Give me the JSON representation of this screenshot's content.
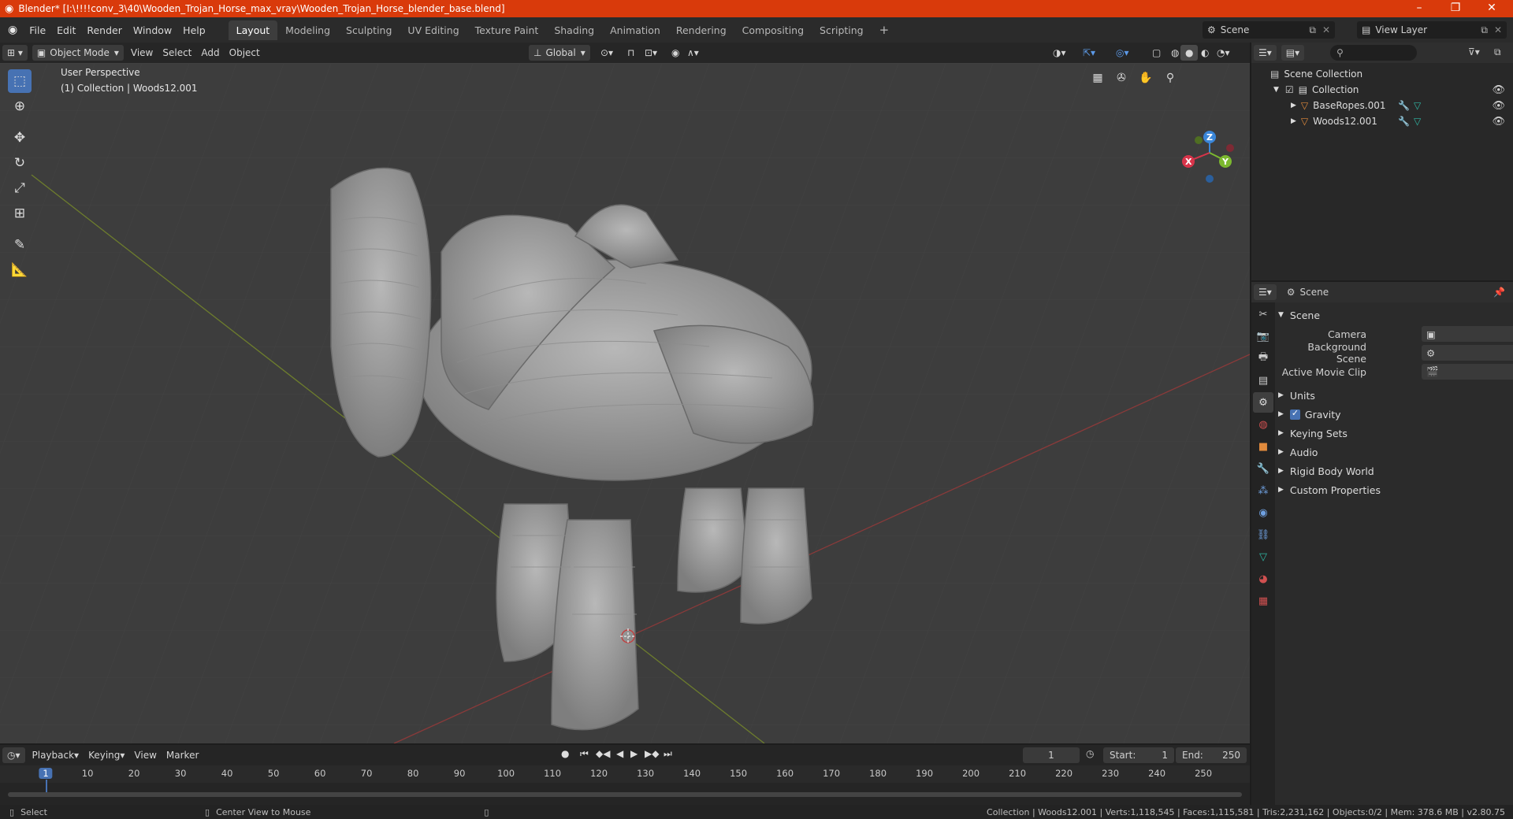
{
  "window": {
    "title": "Blender* [I:\\!!!!conv_3\\40\\Wooden_Trojan_Horse_max_vray\\Wooden_Trojan_Horse_blender_base.blend]"
  },
  "menus": [
    "File",
    "Edit",
    "Render",
    "Window",
    "Help"
  ],
  "workspaces": [
    "Layout",
    "Modeling",
    "Sculpting",
    "UV Editing",
    "Texture Paint",
    "Shading",
    "Animation",
    "Rendering",
    "Compositing",
    "Scripting"
  ],
  "active_workspace": "Layout",
  "scene_selector": "Scene",
  "view_layer_selector": "View Layer",
  "viewport_header": {
    "mode": "Object Mode",
    "menus": [
      "View",
      "Select",
      "Add",
      "Object"
    ],
    "orientation": "Global"
  },
  "viewport": {
    "perspective": "User Perspective",
    "collection_info": "(1) Collection | Woods12.001"
  },
  "gizmo_axes": {
    "x": "X",
    "y": "Y",
    "z": "Z"
  },
  "outliner": {
    "root": "Scene Collection",
    "collection": "Collection",
    "objects": [
      {
        "name": "BaseRopes.001"
      },
      {
        "name": "Woods12.001"
      }
    ]
  },
  "properties": {
    "context": "Scene",
    "panel_title": "Scene",
    "fields": [
      {
        "label": "Camera",
        "value": ""
      },
      {
        "label": "Background Scene",
        "value": ""
      },
      {
        "label": "Active Movie Clip",
        "value": ""
      }
    ],
    "sections": [
      "Units",
      "Gravity",
      "Keying Sets",
      "Audio",
      "Rigid Body World",
      "Custom Properties"
    ],
    "gravity_checked": true
  },
  "timeline": {
    "menus": [
      "Playback",
      "Keying",
      "View",
      "Marker"
    ],
    "current_frame": "1",
    "start_label": "Start:",
    "start": "1",
    "end_label": "End:",
    "end": "250",
    "ruler_marks": [
      "1",
      "10",
      "20",
      "30",
      "40",
      "50",
      "60",
      "70",
      "80",
      "90",
      "100",
      "110",
      "120",
      "130",
      "140",
      "150",
      "160",
      "170",
      "180",
      "190",
      "200",
      "210",
      "220",
      "230",
      "240",
      "250"
    ]
  },
  "statusbar": {
    "left_action": "Select",
    "middle_action": "Center View to Mouse",
    "stats": "Collection | Woods12.001 | Verts:1,118,545 | Faces:1,115,581 | Tris:2,231,162 | Objects:0/2 | Mem: 378.6 MB | v2.80.75"
  },
  "colors": {
    "title_bar": "#d93a0b",
    "active_tool": "#4772b3",
    "x_axis": "#d8344a",
    "y_axis": "#7cb82f",
    "z_axis": "#3a86d8",
    "object_icon": "#e08a3c",
    "mesh_icon": "#30b8a5"
  }
}
